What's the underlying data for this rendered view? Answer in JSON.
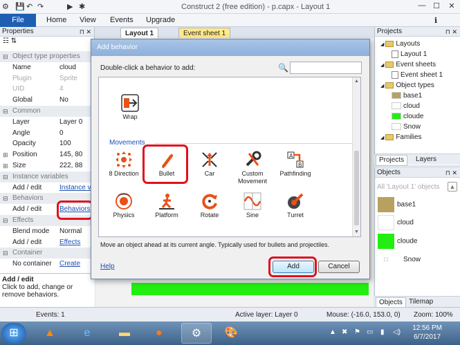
{
  "window": {
    "title": "Construct 2  (free edition) - p.capx - Layout 1"
  },
  "ribbon": {
    "tabs": [
      "File",
      "Home",
      "View",
      "Events",
      "Upgrade"
    ]
  },
  "properties": {
    "header": "Properties",
    "rows": [
      {
        "type": "section",
        "key": "Object type properties"
      },
      {
        "key": "Name",
        "value": "cloud"
      },
      {
        "key": "Plugin",
        "value": "Sprite",
        "grey": true
      },
      {
        "key": "UID",
        "value": "4",
        "grey": true
      },
      {
        "key": "Global",
        "value": "No"
      },
      {
        "type": "section",
        "key": "Common"
      },
      {
        "key": "Layer",
        "value": "Layer 0"
      },
      {
        "key": "Angle",
        "value": "0"
      },
      {
        "key": "Opacity",
        "value": "100"
      },
      {
        "key": "Position",
        "value": "145, 80",
        "expand": true
      },
      {
        "key": "Size",
        "value": "222, 88",
        "expand": true
      },
      {
        "type": "section",
        "key": "Instance variables"
      },
      {
        "key": "Add / edit",
        "link": "Instance v"
      },
      {
        "type": "section",
        "key": "Behaviors"
      },
      {
        "key": "Add / edit",
        "link": "Behaviors"
      },
      {
        "type": "section",
        "key": "Effects"
      },
      {
        "key": "Blend mode",
        "value": "Normal"
      },
      {
        "key": "Add / edit",
        "link": "Effects"
      },
      {
        "type": "section",
        "key": "Container"
      },
      {
        "key": "No container",
        "link": "Create"
      }
    ],
    "help_title": "Add / edit",
    "help_text": "Click to add, change or remove behaviors."
  },
  "doc_tabs": [
    "Layout 1",
    "Event sheet 1"
  ],
  "projects": {
    "header": "Projects",
    "tree": [
      {
        "label": "Layouts",
        "kind": "folder",
        "indent": 0
      },
      {
        "label": "Layout 1",
        "kind": "page",
        "indent": 1
      },
      {
        "label": "Event sheets",
        "kind": "folder",
        "indent": 0
      },
      {
        "label": "Event sheet 1",
        "kind": "page",
        "indent": 1
      },
      {
        "label": "Object types",
        "kind": "folder",
        "indent": 0
      },
      {
        "label": "base1",
        "kind": "swatch",
        "color": "#b8a060",
        "indent": 1
      },
      {
        "label": "cloud",
        "kind": "swatch",
        "color": "#ffffff",
        "indent": 1
      },
      {
        "label": "cloude",
        "kind": "swatch",
        "color": "#22ee11",
        "indent": 1
      },
      {
        "label": "Snow",
        "kind": "swatch",
        "color": "#ffffff",
        "indent": 1
      },
      {
        "label": "Families",
        "kind": "folder",
        "indent": 0
      }
    ],
    "tabs": [
      "Projects",
      "Layers"
    ]
  },
  "objects": {
    "header": "Objects",
    "filter": "All 'Layout 1' objects",
    "items": [
      {
        "label": "base1",
        "color": "#b8a060"
      },
      {
        "label": "cloud",
        "color": "#ffffff"
      },
      {
        "label": "cloude",
        "color": "#22ee11"
      },
      {
        "label": "Snow",
        "color": "#ffffff"
      }
    ],
    "tabs": [
      "Objects",
      "Tilemap"
    ]
  },
  "status": {
    "events": "Events: 1",
    "layer": "Active layer: Layer 0",
    "mouse": "Mouse: (-16.0, 153.0, 0)",
    "zoom": "Zoom: 100%"
  },
  "dialog": {
    "title": "Add behavior",
    "instruction": "Double-click a behavior to add:",
    "search_value": "",
    "category": "Movements",
    "top_items": [
      {
        "label": "Wrap",
        "icon": "wrap-icon"
      }
    ],
    "items": [
      {
        "label": "8 Direction",
        "icon": "eight-direction-icon"
      },
      {
        "label": "Bullet",
        "icon": "bullet-icon"
      },
      {
        "label": "Car",
        "icon": "car-icon"
      },
      {
        "label": "Custom Movement",
        "icon": "custom-movement-icon"
      },
      {
        "label": "Pathfinding",
        "icon": "pathfinding-icon"
      },
      {
        "label": "Physics",
        "icon": "physics-icon"
      },
      {
        "label": "Platform",
        "icon": "platform-icon"
      },
      {
        "label": "Rotate",
        "icon": "rotate-icon"
      },
      {
        "label": "Sine",
        "icon": "sine-icon"
      },
      {
        "label": "Turret",
        "icon": "turret-icon"
      }
    ],
    "description": "Move an object ahead at its current angle.  Typically used for bullets and projectiles.",
    "help_label": "Help",
    "add_label": "Add",
    "cancel_label": "Cancel"
  },
  "taskbar": {
    "time": "12:56 PM",
    "date": "6/7/2017"
  },
  "accent": "#1e5fb4",
  "highlight": "#e0101c"
}
